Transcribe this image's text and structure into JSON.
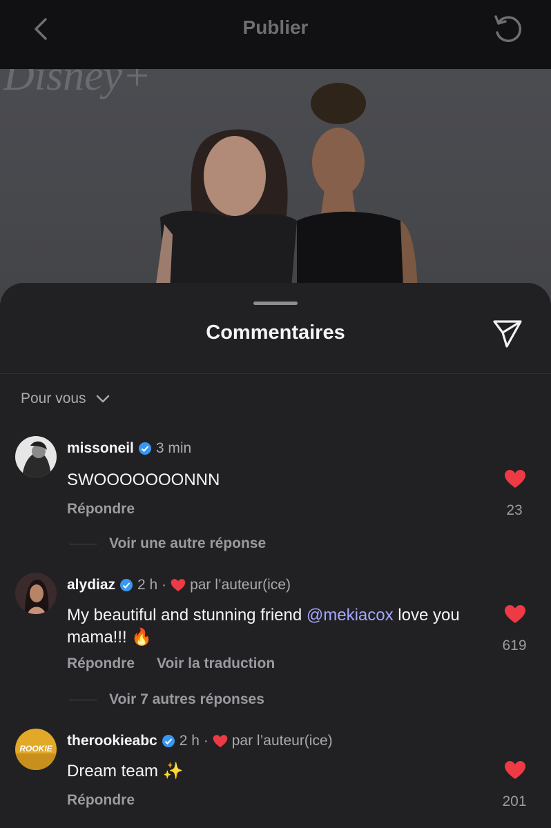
{
  "header": {
    "title": "Publier",
    "back_icon": "chevron-left-icon",
    "refresh_icon": "refresh-icon"
  },
  "sheet": {
    "title": "Commentaires",
    "send_icon": "send-icon",
    "filter_label": "Pour vous"
  },
  "photo": {
    "background_text": "Disney+"
  },
  "comments": [
    {
      "user": "missoneil",
      "verified": true,
      "time": "3 min",
      "author_liked": false,
      "text": "SWOOOOOOONNN",
      "actions": [
        "Répondre"
      ],
      "likes": "23",
      "replies_label": "Voir une autre réponse"
    },
    {
      "user": "alydiaz",
      "verified": true,
      "time": "2 h ·",
      "author_liked": true,
      "author_label": "par l’auteur(ice)",
      "text_before": "My beautiful and stunning friend ",
      "mention": "@mekiacox",
      "text_after": " love you mama!!! 🔥",
      "actions": [
        "Répondre",
        "Voir la traduction"
      ],
      "likes": "619",
      "replies_label": "Voir 7 autres réponses"
    },
    {
      "user": "therookieabc",
      "verified": true,
      "time": "2 h ·",
      "author_liked": true,
      "author_label": "par l’auteur(ice)",
      "text": "Dream team ✨",
      "actions": [
        "Répondre"
      ],
      "likes": "201",
      "avatar_text": "ROOKIE"
    }
  ],
  "colors": {
    "like": "#ee3a44",
    "verified": "#3897f0",
    "mention": "#a4a7ff"
  }
}
